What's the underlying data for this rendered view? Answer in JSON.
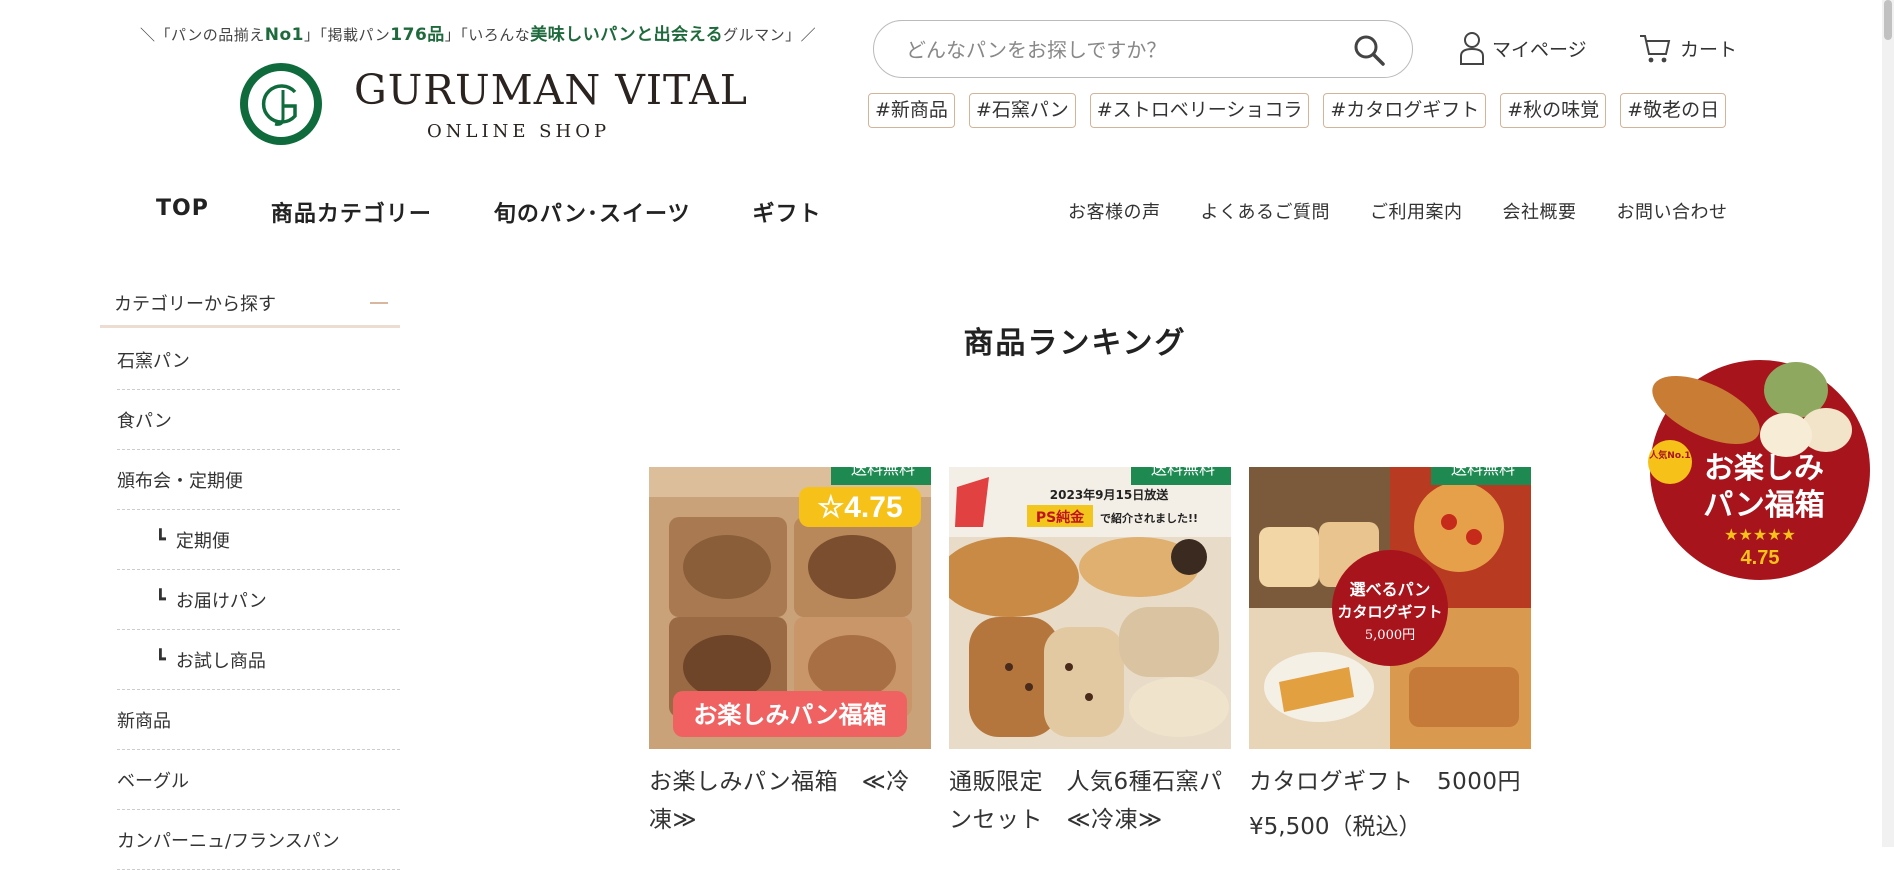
{
  "header": {
    "tagline": {
      "p1": "＼「パンの品揃え",
      "b1": "No1",
      "p2": "」「掲載パン",
      "b2": "176品",
      "p3": "」「いろんな",
      "b3": "美味しいパンと出会える",
      "p4": "グルマン」／"
    },
    "logo_name": "GURUMAN VITAL",
    "logo_sub": "ONLINE SHOP",
    "search_placeholder": "どんなパンをお探しですか？",
    "mypage_label": "マイページ",
    "cart_label": "カート",
    "tags": [
      "#新商品",
      "#石窯パン",
      "#ストロベリーショコラ",
      "#カタログギフト",
      "#秋の味覚",
      "#敬老の日"
    ]
  },
  "main_nav": [
    "TOP",
    "商品カテゴリー",
    "旬のパン･スイーツ",
    "ギフト"
  ],
  "sub_nav": [
    "お客様の声",
    "よくあるご質問",
    "ご利用案内",
    "会社概要",
    "お問い合わせ"
  ],
  "sidebar": {
    "heading": "カテゴリーから探す",
    "items": [
      {
        "label": "石窯パン",
        "sub": false
      },
      {
        "label": "食パン",
        "sub": false
      },
      {
        "label": "頒布会・定期便",
        "sub": false
      },
      {
        "label": "定期便",
        "sub": true
      },
      {
        "label": "お届けパン",
        "sub": true
      },
      {
        "label": "お試し商品",
        "sub": true
      },
      {
        "label": "新商品",
        "sub": false
      },
      {
        "label": "ベーグル",
        "sub": false
      },
      {
        "label": "カンパーニュ/フランスパン",
        "sub": false
      }
    ]
  },
  "ranking": {
    "title": "商品ランキング",
    "products": [
      {
        "badge": "送料無料",
        "name": "お楽しみパン福箱　≪冷凍≫",
        "price": "",
        "img_rating": "☆4.75",
        "img_caption": "お楽しみパン福箱"
      },
      {
        "badge": "送料無料",
        "name": "通販限定　人気6種石窯パンセット　≪冷凍≫",
        "price": "",
        "img_line1": "2023年9月15日放送",
        "img_line2a": "PS純金",
        "img_line2b": "で紹介されました!!"
      },
      {
        "badge": "送料無料",
        "name": "カタログギフト　5000円",
        "price": "¥5,500（税込）",
        "img_line1": "選べるパン",
        "img_line2": "カタログギフト",
        "img_line3": "5,000円"
      }
    ]
  },
  "float_banner": {
    "badge": "人気No.1",
    "line1": "お楽しみ",
    "line2": "パン福箱",
    "stars": "★★★★★",
    "rating": "4.75"
  },
  "colors": {
    "brand_green": "#1e8a52",
    "logo_green": "#0f6b3c",
    "tag_border": "#d2b49a",
    "banner_red": "#a8141c"
  }
}
